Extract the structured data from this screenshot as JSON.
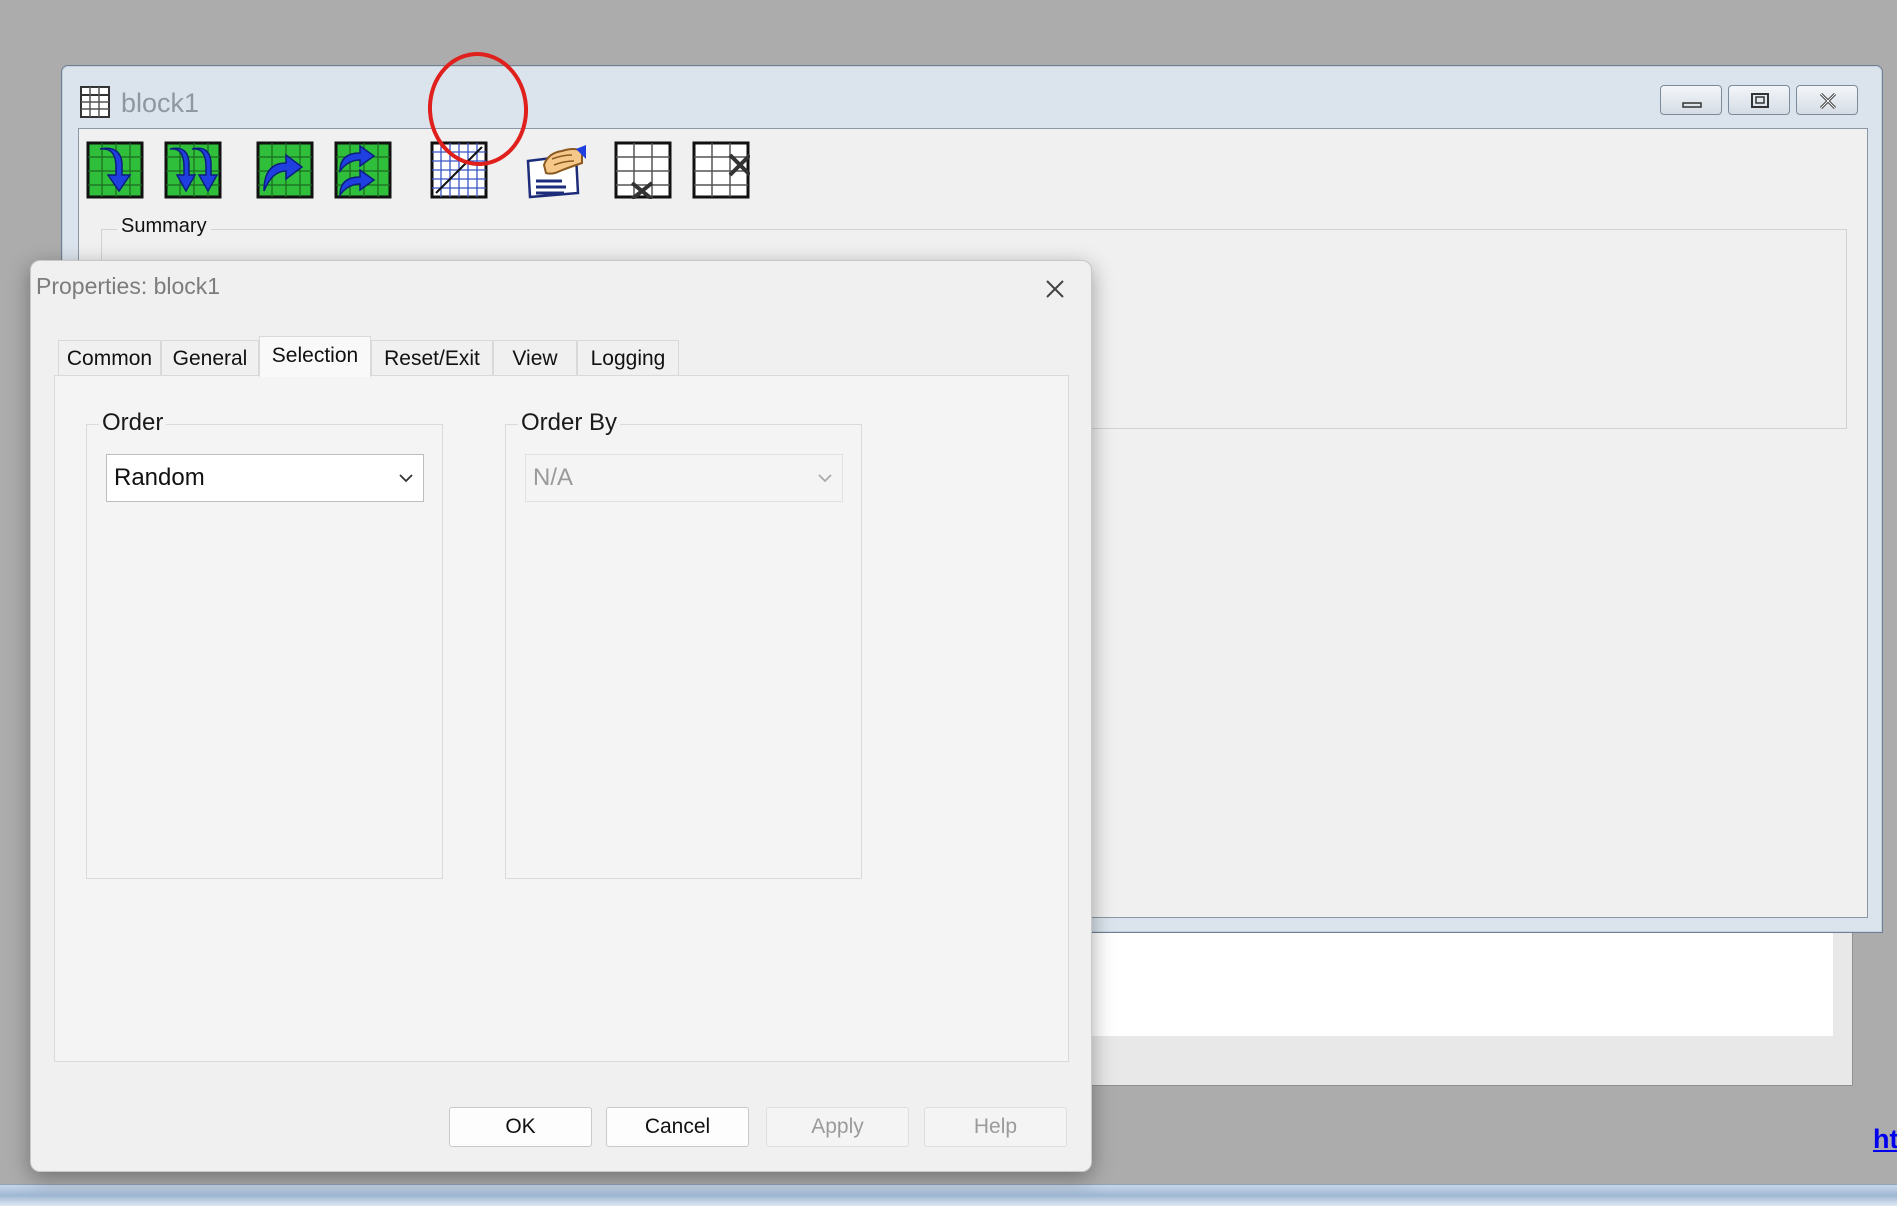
{
  "block_window": {
    "title": "block1",
    "summary_label": "Summary"
  },
  "dialog": {
    "title": "Properties: block1",
    "tabs": [
      {
        "label": "Common"
      },
      {
        "label": "General"
      },
      {
        "label": "Selection",
        "active": true
      },
      {
        "label": "Reset/Exit"
      },
      {
        "label": "View"
      },
      {
        "label": "Logging"
      }
    ],
    "order_group": {
      "label": "Order",
      "value": "Random"
    },
    "order_by_group": {
      "label": "Order By",
      "value": "N/A",
      "disabled": true
    },
    "buttons": {
      "ok": "OK",
      "cancel": "Cancel",
      "apply": "Apply",
      "help": "Help"
    }
  },
  "corner_link": "ht",
  "colors": {
    "highlight": "#e0201c",
    "desktop": "#acacac",
    "dialog_bg": "#f0f0f0",
    "link": "#0000ee"
  }
}
